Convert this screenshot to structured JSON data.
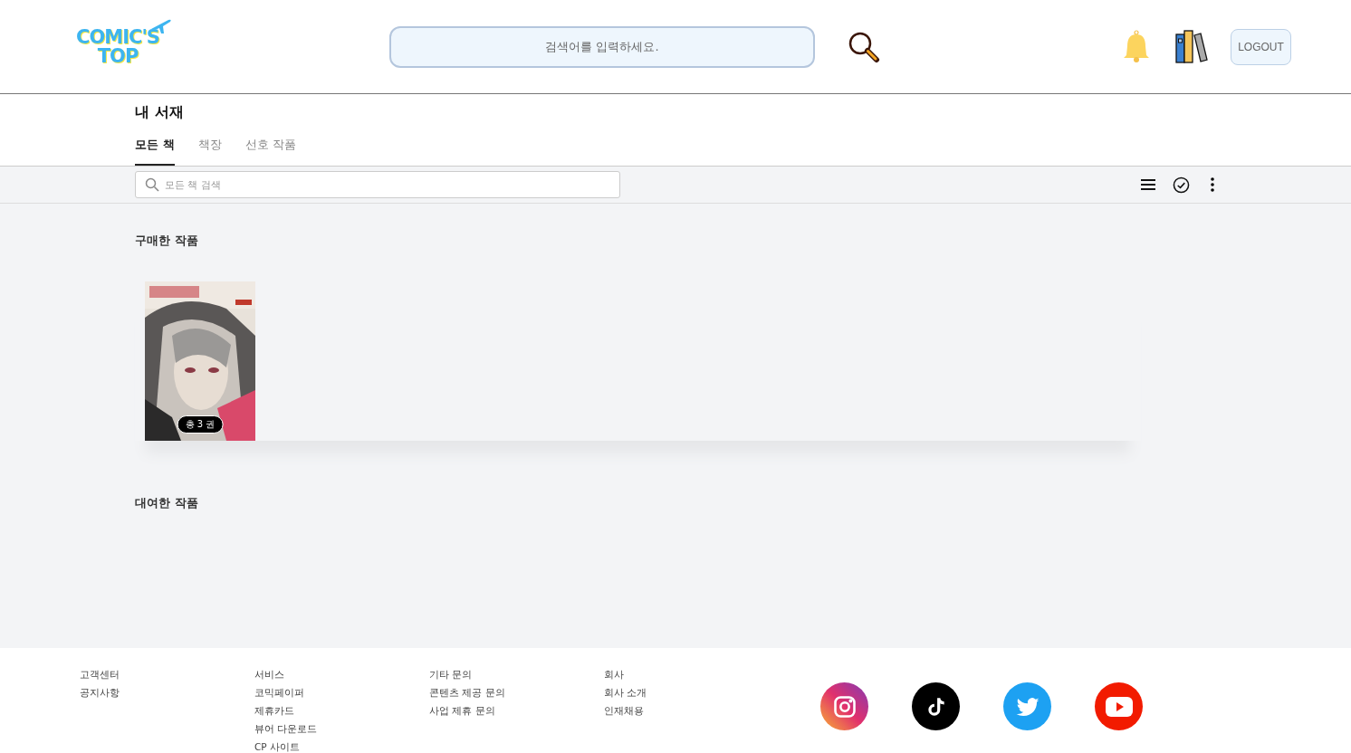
{
  "header": {
    "logo": {
      "line1": "COMIC'S",
      "line2": "TOP"
    },
    "search": {
      "placeholder": "검색어를 입력하세요."
    },
    "logout": "LOGOUT"
  },
  "library": {
    "title": "내 서재",
    "tabs": [
      {
        "label": "모든 책",
        "selected": true
      },
      {
        "label": "책장",
        "selected": false
      },
      {
        "label": "선호 작품",
        "selected": false
      }
    ],
    "search": {
      "placeholder": "모든 책 검색"
    }
  },
  "sections": [
    {
      "title": "구매한 작품",
      "books": [
        {
          "kind": "picture",
          "badge": "총 3 권"
        }
      ]
    },
    {
      "title": "대여한 작품"
    }
  ],
  "footer": {
    "columns": [
      [
        "고객센터",
        "공지사항"
      ],
      [
        "서비스",
        "코믹페이퍼",
        "제휴카드",
        "뷰어 다운로드",
        "CP 사이트"
      ],
      [
        "기타 문의",
        "콘텐츠 제공 문의",
        "사업 제휴 문의"
      ],
      [
        "회사",
        "회사 소개",
        "인재채용"
      ]
    ],
    "social": [
      {
        "kind": "instagram"
      },
      {
        "kind": "tiktok"
      },
      {
        "kind": "twitter"
      },
      {
        "kind": "youtube"
      }
    ]
  }
}
